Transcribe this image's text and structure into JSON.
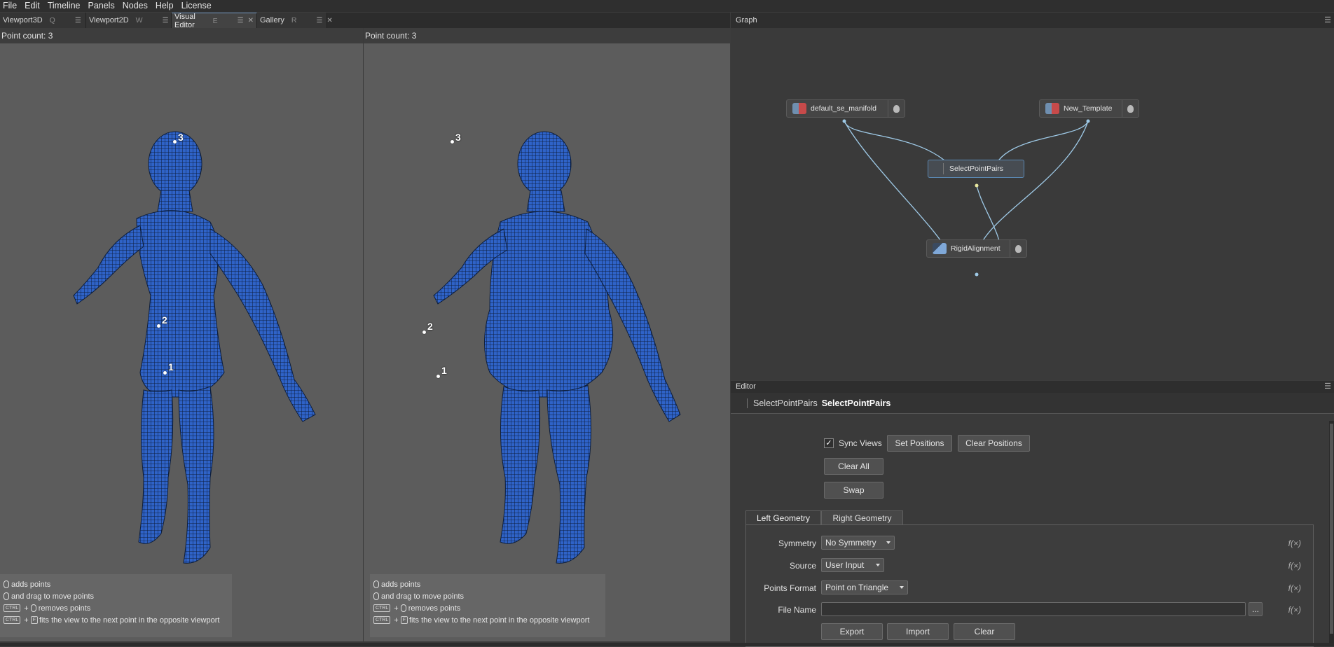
{
  "menu": [
    "File",
    "Edit",
    "Timeline",
    "Panels",
    "Nodes",
    "Help",
    "License"
  ],
  "tabs": [
    {
      "label": "Viewport3D",
      "shortcut": "Q"
    },
    {
      "label": "Viewport2D",
      "shortcut": "W"
    },
    {
      "label": "Visual Editor",
      "shortcut": "E"
    },
    {
      "label": "Gallery",
      "shortcut": "R"
    }
  ],
  "tab_buttons": {
    "menu": "☰",
    "close": "✕"
  },
  "viewports": [
    {
      "point_count": "Point count: 3",
      "points": [
        "1",
        "2",
        "3"
      ]
    },
    {
      "point_count": "Point count: 3",
      "points": [
        "1",
        "2",
        "3"
      ]
    }
  ],
  "hints": {
    "adds": "adds points",
    "drag": "and drag to move points",
    "remove": "removes points",
    "fit": "fits the view to the next point in the opposite viewport",
    "ctrl": "CTRL",
    "f": "F",
    "plus": "+"
  },
  "graph": {
    "title": "Graph",
    "menu": "☰",
    "nodes": {
      "a": "default_se_manifold",
      "b": "New_Template",
      "c": "SelectPointPairs",
      "d": "RigidAlignment"
    },
    "node_icons": {
      "a": "mesh-icon",
      "b": "mesh-icon",
      "c": "point-pairs-icon",
      "d": "alignment-icon"
    }
  },
  "editor": {
    "title": "Editor",
    "menu": "☰",
    "node_type": "SelectPointPairs",
    "node_name": "SelectPointPairs",
    "sync_views": "Sync Views",
    "sync_checked": "✓",
    "set_positions": "Set Positions",
    "clear_positions": "Clear Positions",
    "clear_all": "Clear All",
    "swap": "Swap",
    "tab_left": "Left Geometry",
    "tab_right": "Right Geometry",
    "rows": {
      "symmetry": {
        "label": "Symmetry",
        "value": "No Symmetry"
      },
      "source": {
        "label": "Source",
        "value": "User Input"
      },
      "points_format": {
        "label": "Points Format",
        "value": "Point on Triangle"
      },
      "file_name": {
        "label": "File Name",
        "value": ""
      }
    },
    "fx": "f(×)",
    "browse": "...",
    "export": "Export",
    "import": "Import",
    "clear": "Clear"
  },
  "colors": {
    "mesh": "#2f63c8",
    "accent": "#6a8fb8",
    "edge": "#9ec9e6"
  }
}
